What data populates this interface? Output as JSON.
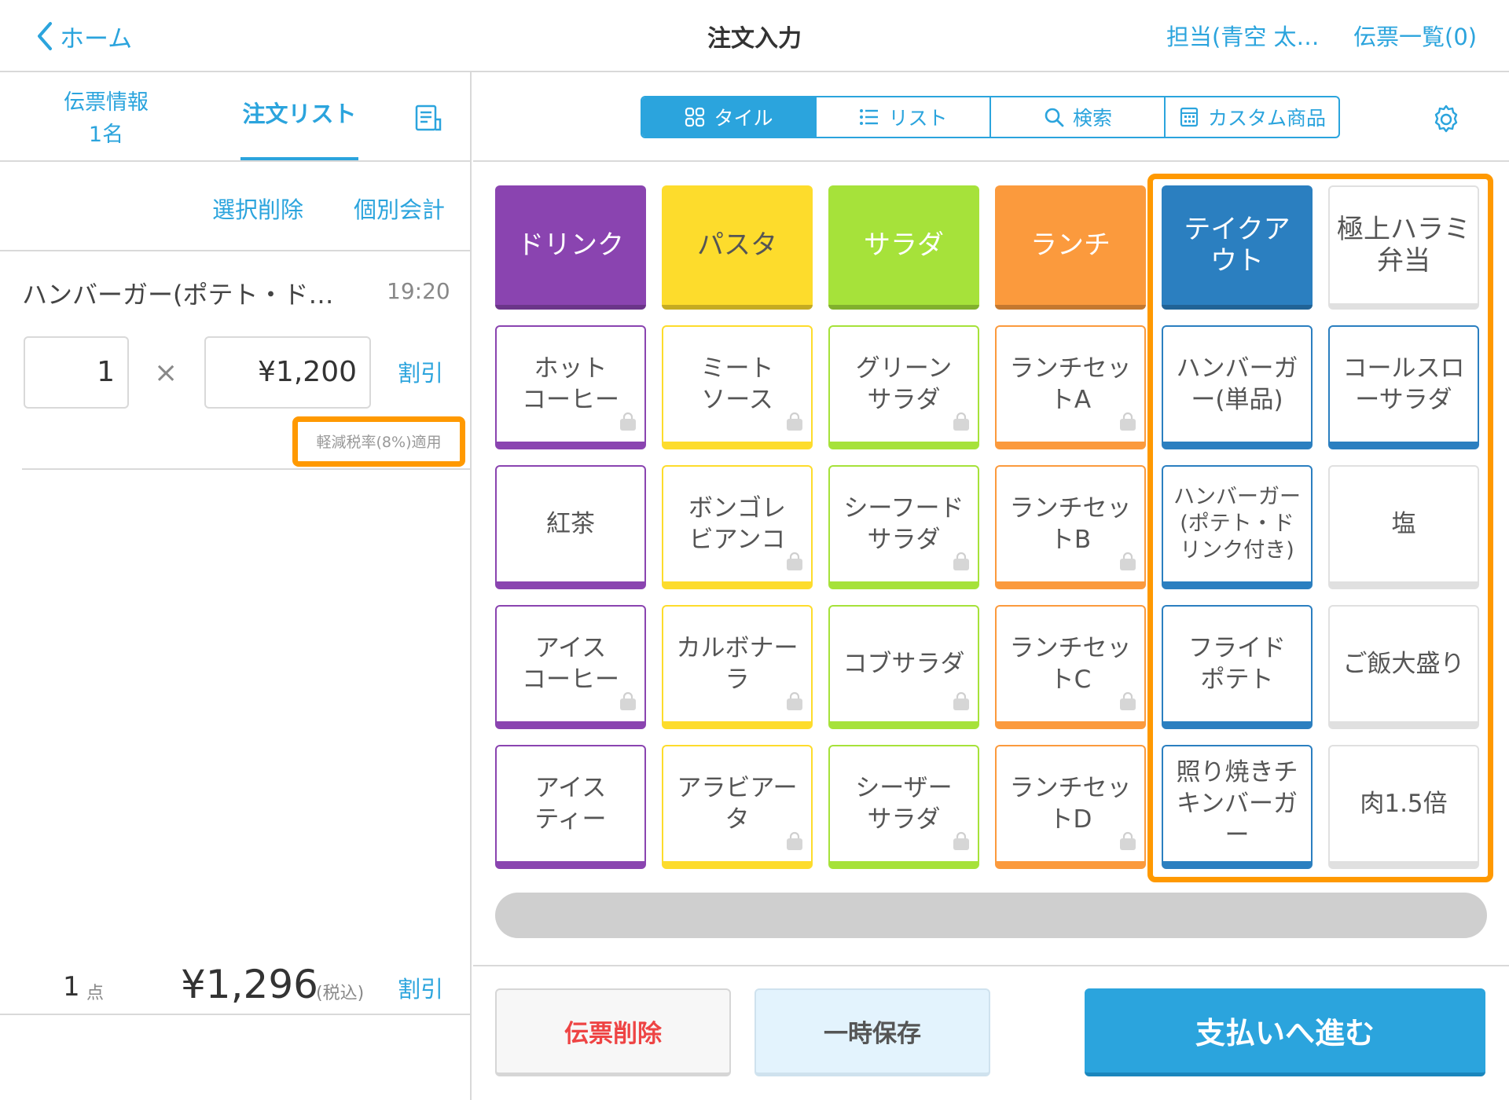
{
  "header": {
    "back_label": "ホーム",
    "title": "注文入力",
    "staff_label": "担当(青空 太…",
    "slips_label": "伝票一覧(0)"
  },
  "left_tabs": {
    "slip_info_line1": "伝票情報",
    "slip_info_line2": "1名",
    "order_list": "注文リスト"
  },
  "list_actions": {
    "delete_selected": "選択削除",
    "split_payment": "個別会計"
  },
  "order_item": {
    "name": "ハンバーガー(ポテト・ド…",
    "time": "19:20",
    "quantity": "1",
    "multiply_symbol": "×",
    "price": "¥1,200",
    "discount_label": "割引",
    "tax_label": "軽減税率(8%)適用"
  },
  "footer": {
    "count": "1",
    "count_unit": "点",
    "total": "¥1,296",
    "tax_included": "(税込)",
    "discount_label": "割引"
  },
  "view_tabs": [
    {
      "label": "タイル",
      "icon": "grid-icon",
      "active": true
    },
    {
      "label": "リスト",
      "icon": "list-icon",
      "active": false
    },
    {
      "label": "検索",
      "icon": "search-icon",
      "active": false
    },
    {
      "label": "カスタム商品",
      "icon": "calculator-icon",
      "active": false
    }
  ],
  "categories": [
    {
      "label": "ドリンク",
      "color": "#8a44b0"
    },
    {
      "label": "パスタ",
      "color": "#fddc2c"
    },
    {
      "label": "サラダ",
      "color": "#a6e23a"
    },
    {
      "label": "ランチ",
      "color": "#fb9a3d"
    },
    {
      "label": "テイクア\nウト",
      "color": "#2b7fc0"
    },
    {
      "label": "極上ハラミ\n弁当",
      "color": "#e0e0e0"
    }
  ],
  "products": [
    {
      "label": "ホット\nコーヒー",
      "color": "#8a44b0",
      "takeout_bag": true
    },
    {
      "label": "ミート\nソース",
      "color": "#fddc2c",
      "takeout_bag": true
    },
    {
      "label": "グリーン\nサラダ",
      "color": "#a6e23a",
      "takeout_bag": true
    },
    {
      "label": "ランチセッ\nトA",
      "color": "#fb9a3d",
      "takeout_bag": true
    },
    {
      "label": "ハンバーガ\nー(単品)",
      "color": "#2b7fc0",
      "takeout_bag": false
    },
    {
      "label": "コールスロ\nーサラダ",
      "color": "#2b7fc0",
      "takeout_bag": false
    },
    {
      "label": "紅茶",
      "color": "#8a44b0",
      "takeout_bag": false
    },
    {
      "label": "ボンゴレ\nビアンコ",
      "color": "#fddc2c",
      "takeout_bag": true
    },
    {
      "label": "シーフード\nサラダ",
      "color": "#a6e23a",
      "takeout_bag": true
    },
    {
      "label": "ランチセッ\nトB",
      "color": "#fb9a3d",
      "takeout_bag": true
    },
    {
      "label": "ハンバーガー\n(ポテト・ド\nリンク付き)",
      "color": "#2b7fc0",
      "takeout_bag": false,
      "small": true
    },
    {
      "label": "塩",
      "color": "#e0e0e0",
      "takeout_bag": false
    },
    {
      "label": "アイス\nコーヒー",
      "color": "#8a44b0",
      "takeout_bag": true
    },
    {
      "label": "カルボナー\nラ",
      "color": "#fddc2c",
      "takeout_bag": true
    },
    {
      "label": "コブサラダ",
      "color": "#a6e23a",
      "takeout_bag": true
    },
    {
      "label": "ランチセッ\nトC",
      "color": "#fb9a3d",
      "takeout_bag": true
    },
    {
      "label": "フライド\nポテト",
      "color": "#2b7fc0",
      "takeout_bag": false
    },
    {
      "label": "ご飯大盛り",
      "color": "#e0e0e0",
      "takeout_bag": false
    },
    {
      "label": "アイス\nティー",
      "color": "#8a44b0",
      "takeout_bag": false
    },
    {
      "label": "アラビアー\nタ",
      "color": "#fddc2c",
      "takeout_bag": true
    },
    {
      "label": "シーザー\nサラダ",
      "color": "#a6e23a",
      "takeout_bag": true
    },
    {
      "label": "ランチセッ\nトD",
      "color": "#fb9a3d",
      "takeout_bag": true
    },
    {
      "label": "照り焼きチ\nキンバーガ\nー",
      "color": "#2b7fc0",
      "takeout_bag": false
    },
    {
      "label": "肉1.5倍",
      "color": "#e0e0e0",
      "takeout_bag": false
    }
  ],
  "bottom_buttons": {
    "delete_slip": "伝票削除",
    "hold": "一時保存",
    "proceed_payment": "支払いへ進む"
  },
  "colors": {
    "accent": "#2ba4dd",
    "highlight": "#ff9900",
    "danger": "#ee4444"
  }
}
